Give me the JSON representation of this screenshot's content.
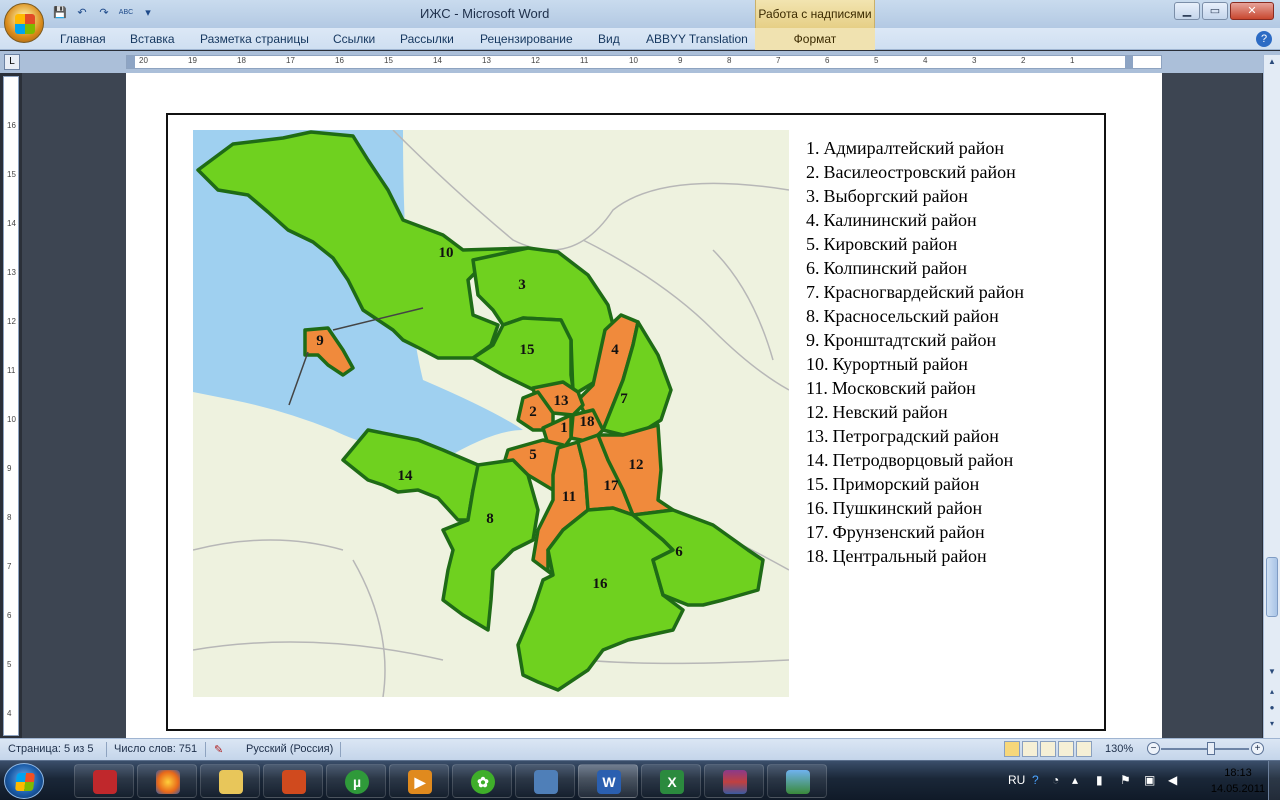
{
  "window": {
    "title": "ИЖС - Microsoft Word",
    "context_tab_group": "Работа с надписями",
    "buttons": {
      "minimize": "▁",
      "maximize": "▭",
      "close": "✕"
    }
  },
  "ribbon": {
    "tabs": [
      "Главная",
      "Вставка",
      "Разметка страницы",
      "Ссылки",
      "Рассылки",
      "Рецензирование",
      "Вид",
      "ABBYY Translation"
    ],
    "context_tab": "Формат",
    "help": "?"
  },
  "qat": {
    "save": "💾",
    "undo": "↶",
    "redo": "↷",
    "spell": "ABC",
    "more": "▾"
  },
  "ruler": {
    "corner": "L",
    "h_numbers": [
      "20",
      "19",
      "18",
      "17",
      "16",
      "15",
      "14",
      "13",
      "12",
      "11",
      "10",
      "9",
      "8",
      "7",
      "6",
      "5",
      "4",
      "3",
      "2",
      "1"
    ],
    "v_numbers": [
      "16",
      "15",
      "14",
      "13",
      "12",
      "11",
      "10",
      "9",
      "8",
      "7",
      "6",
      "5",
      "4"
    ]
  },
  "map": {
    "district_labels": [
      "1",
      "2",
      "3",
      "4",
      "5",
      "6",
      "7",
      "8",
      "9",
      "10",
      "11",
      "12",
      "13",
      "14",
      "15",
      "16",
      "17",
      "18"
    ],
    "colors": {
      "water": "#9fd0f0",
      "land": "#eef2df",
      "outer": "#6fd11f",
      "central": "#f08a3c",
      "border": "#1f6b16"
    }
  },
  "legend": {
    "items": [
      {
        "n": "1.",
        "name": "Адмиралтейский район"
      },
      {
        "n": "2.",
        "name": "Василеостровский район"
      },
      {
        "n": "3.",
        "name": "Выборгский район"
      },
      {
        "n": "4.",
        "name": "Калининский район"
      },
      {
        "n": "5.",
        "name": "Кировский район"
      },
      {
        "n": "6.",
        "name": "Колпинский район"
      },
      {
        "n": "7.",
        "name": "Красногвардейский район"
      },
      {
        "n": "8.",
        "name": "Красносельский район"
      },
      {
        "n": "9.",
        "name": "Кронштадтский район"
      },
      {
        "n": "10.",
        "name": "Курортный район"
      },
      {
        "n": "11.",
        "name": "Московский район"
      },
      {
        "n": "12.",
        "name": "Невский район"
      },
      {
        "n": "13.",
        "name": "Петроградский район"
      },
      {
        "n": "14.",
        "name": "Петродворцовый район"
      },
      {
        "n": "15.",
        "name": "Приморский район"
      },
      {
        "n": "16.",
        "name": "Пушкинский район"
      },
      {
        "n": "17.",
        "name": "Фрунзенский район"
      },
      {
        "n": "18.",
        "name": "Центральный район"
      }
    ]
  },
  "status": {
    "page": "Страница: 5 из 5",
    "words": "Число слов: 751",
    "language": "Русский (Россия)",
    "zoom": "130%",
    "zoom_minus": "−",
    "zoom_plus": "+"
  },
  "taskbar": {
    "apps": [
      "pdf-reader",
      "firefox",
      "explorer",
      "powerpoint",
      "utorrent",
      "media-player",
      "icq",
      "control-panel",
      "word",
      "excel",
      "winrar",
      "image-viewer"
    ],
    "icon_glyphs": {
      "utorrent": "µ",
      "word": "W",
      "excel": "X",
      "icq": "✿",
      "media": "▶"
    },
    "lang": "RU",
    "time": "18:13",
    "date": "14.05.2011"
  }
}
